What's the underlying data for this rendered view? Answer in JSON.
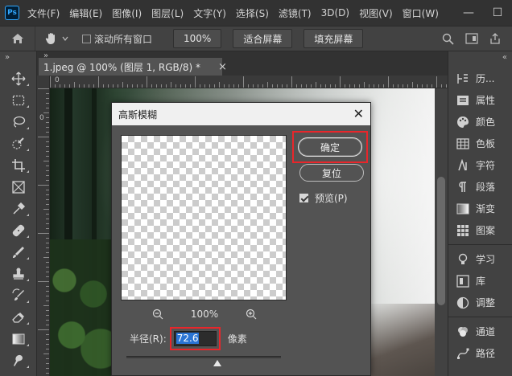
{
  "app": {
    "logo": "Ps"
  },
  "menu": [
    "文件(F)",
    "编辑(E)",
    "图像(I)",
    "图层(L)",
    "文字(Y)",
    "选择(S)",
    "滤镜(T)",
    "3D(D)",
    "视图(V)",
    "窗口(W)"
  ],
  "window_controls": {
    "minimize": "—",
    "maximize": "☐"
  },
  "options_bar": {
    "scroll_all_label": "滚动所有窗口",
    "scroll_all_checked": false,
    "zoom_btn": "100%",
    "fit_screen_btn": "适合屏幕",
    "fill_screen_btn": "填充屏幕"
  },
  "document": {
    "tab_label": "1.jpeg @ 100% (图层 1, RGB/8) *",
    "tab_close": "×"
  },
  "rulers": {
    "h_label": "0",
    "v_label": "0"
  },
  "right_panels": [
    {
      "label": "历...",
      "icon": "history-icon"
    },
    {
      "label": "属性",
      "icon": "properties-icon"
    },
    {
      "label": "颜色",
      "icon": "color-palette-icon"
    },
    {
      "label": "色板",
      "icon": "swatches-icon"
    },
    {
      "label": "字符",
      "icon": "character-icon"
    },
    {
      "label": "段落",
      "icon": "paragraph-icon"
    },
    {
      "label": "渐变",
      "icon": "gradient-icon"
    },
    {
      "label": "图案",
      "icon": "pattern-icon"
    },
    {
      "label": "学习",
      "icon": "learn-icon"
    },
    {
      "label": "库",
      "icon": "libraries-icon"
    },
    {
      "label": "调整",
      "icon": "adjustments-icon"
    },
    {
      "label": "通道",
      "icon": "channels-icon"
    },
    {
      "label": "路径",
      "icon": "paths-icon"
    }
  ],
  "dialog": {
    "title": "高斯模糊",
    "close": "✕",
    "ok_label": "确定",
    "reset_label": "复位",
    "preview_label": "预览(P)",
    "preview_checked": true,
    "zoom_level": "100%",
    "radius_label": "半径(R):",
    "radius_value": "72.6",
    "radius_unit": "像素"
  },
  "colors": {
    "highlight_red": "#e8262b",
    "ps_blue": "#31a8ff",
    "selection_blue": "#2a74d4"
  }
}
